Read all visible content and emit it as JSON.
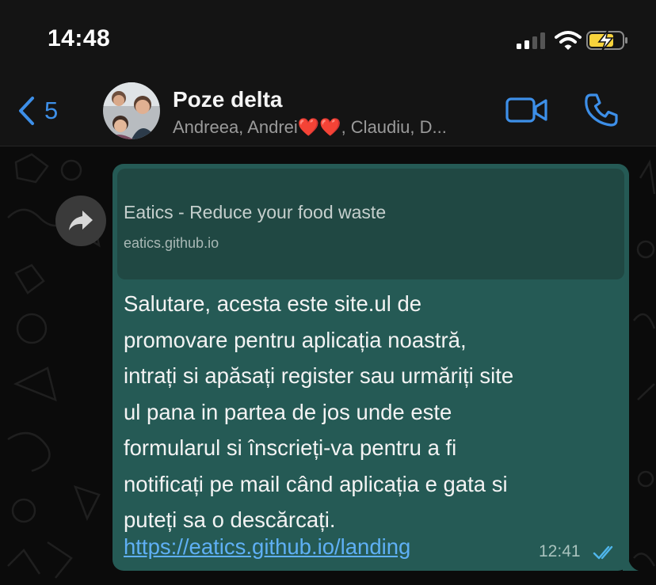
{
  "status_bar": {
    "time": "14:48"
  },
  "header": {
    "back_count": "5",
    "title": "Poze delta",
    "subtitle": "Andreea, Andrei❤️❤️, Claudiu, D..."
  },
  "message": {
    "preview_title": "Eatics - Reduce your food waste",
    "preview_url": "eatics.github.io",
    "text": "Salutare, acesta este site.ul de\npromovare pentru aplicația noastră,\nintrați si apăsați register sau urmăriți site\nul pana in partea de jos unde este\nformularul si înscrieți-va pentru a fi\nnotificați pe mail când aplicația e gata si\nputeți sa o descărcați.",
    "link": "https://eatics.github.io/landing",
    "time": "12:41"
  },
  "colors": {
    "accent": "#3d8fe8",
    "bubble": "#255a55",
    "link": "#5fb0f5",
    "battery_fill": "#f7d33c"
  }
}
